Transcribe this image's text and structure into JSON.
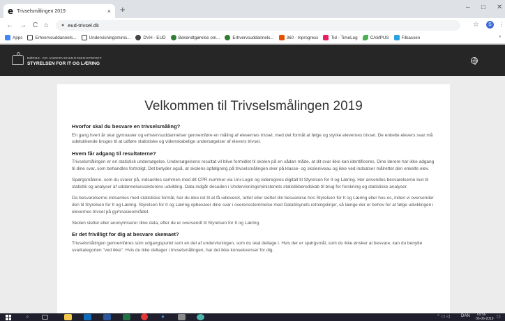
{
  "browser": {
    "tab_title": "Trivselsmålingen 2019",
    "tab_close": "×",
    "new_tab": "+",
    "window_controls": {
      "minimize": "–",
      "maximize": "□",
      "close": "✕"
    },
    "url": "eud-trivsel.dk",
    "nav": {
      "back": "←",
      "forward": "→",
      "reload": "C",
      "home": "⌂"
    },
    "star": "☆",
    "profile_initial": "S",
    "menu": "⋮"
  },
  "bookmarks": [
    {
      "label": "Apps",
      "icon": "apps-grid",
      "color": "#4285f4"
    },
    {
      "label": "Erhvervsuddannels...",
      "icon": "crown",
      "color": "#333333"
    },
    {
      "label": "Undervisningsminis...",
      "icon": "crown",
      "color": "#333333"
    },
    {
      "label": "DVH - EUD",
      "icon": "circle",
      "color": "#444444"
    },
    {
      "label": "Bekendtgørelse om...",
      "icon": "circle",
      "color": "#2e7d32"
    },
    {
      "label": "Erhvervsuddannels...",
      "icon": "circle",
      "color": "#2e7d32"
    },
    {
      "label": "360 - Inprogress",
      "icon": "f-logo",
      "color": "#e65100"
    },
    {
      "label": "Tid - TimeLog",
      "icon": "square",
      "color": "#e91e63"
    },
    {
      "label": "CAMPUS",
      "icon": "leaf",
      "color": "#4caf50"
    },
    {
      "label": "Filkassen",
      "icon": "square",
      "color": "#29a3e0"
    }
  ],
  "bookmarks_overflow": "»",
  "site_header": {
    "ministry_line1": "BØRNE- OG UNDERVISNINGSMINISTERIET",
    "ministry_line2": "STYRELSEN FOR IT OG LÆRING"
  },
  "page": {
    "title": "Velkommen til Trivselsmålingen 2019",
    "sections": [
      {
        "heading": "Hvorfor skal du besvare en trivselsmåling?",
        "paragraphs": [
          "En gang hvert år skal gymnasier og erhvervsuddannelser gennemføre en måling af elevernes trivsel, med det formål at følge og styrke elevernes trivsel. De enkelte elevers svar må udelukkende bruges til at udføre statistiske og videnskabelige undersøgelser af elevers trivsel."
        ]
      },
      {
        "heading": "Hvem får adgang til resultaterne?",
        "paragraphs": [
          "Trivselsmålingen er en statistisk undersøgelse. Undersøgelsens resultat vil blive formidlet til skolen på en sådan måde, at dit svar ikke kan identificeres. Dine lærere har ikke adgang til dine svar, som behandles fortroligt. Det betyder også, at skolens opfølgning på trivselsmålingen sker på klasse- og skoleniveau og ikke ved indsatser målrettet den enkelte elev.",
          "Spørgsmålene, som du svarer på, indsamles sammen med dit CPR-nummer via Uni-Login og videregives digitalt til Styrelsen for It og Læring. Her anvendes besvarelserne kun til statistik og analyser af uddannelsessektorens udvikling. Data indgår desuden i Undervisningsministeriets statistikberedskab til brug for forskning og statistiske analyser.",
          "Da besvarelserne indsamles med statistiske formål, har du ikke ret til at få udleveret, rettet eller slettet din besvarelse hos Styrelsen for It og Læring eller hos os, inden vi oversender den til Styrelsen for It og Læring. Styrelsen for It og Læring opbevarer dine svar i overensstemmelse med Datatilsynets retningslinjer, så længe der er behov for at følge udviklingen i elevernes trivsel på gymnasieområdet.",
          "Skolen sletter eller anonymiserer dine data, efter de er oversendt til Styrelsen for It og Læring."
        ]
      },
      {
        "heading": "Er det frivilligt for dig at besvare skemaet?",
        "paragraphs": [
          "Trivselsmålingen gennemføres som udgangspunkt som en del af undervisningen, som du skal deltage i. Hvis der er spørgsmål, som du ikke ønsker at besvare, kan du benytte svarkategorien \"ved ikke\". Hvis du ikke deltager i trivselsmålingen, har det ikke konsekvenser for dig."
        ]
      }
    ]
  },
  "taskbar": {
    "search_icon": "⌕",
    "language": "DAN",
    "time": "09:56",
    "date": "05-06-2019"
  }
}
